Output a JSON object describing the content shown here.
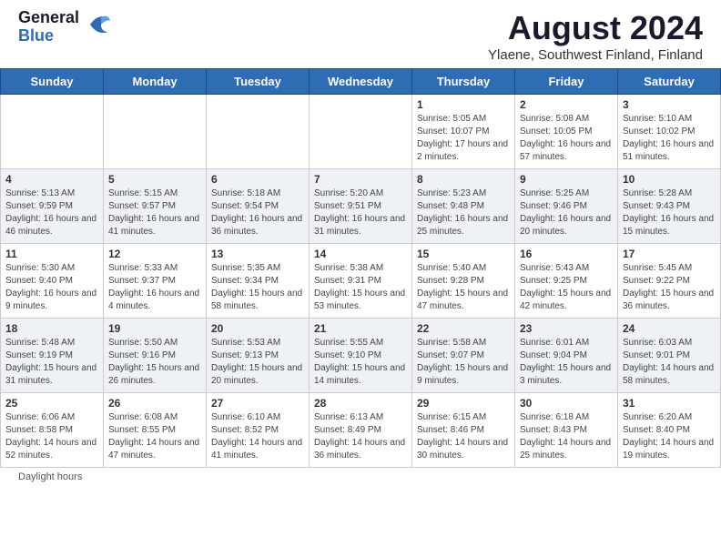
{
  "header": {
    "logo_general": "General",
    "logo_blue": "Blue",
    "main_title": "August 2024",
    "subtitle": "Ylaene, Southwest Finland, Finland"
  },
  "days": [
    "Sunday",
    "Monday",
    "Tuesday",
    "Wednesday",
    "Thursday",
    "Friday",
    "Saturday"
  ],
  "weeks": [
    [
      {
        "date": "",
        "info": ""
      },
      {
        "date": "",
        "info": ""
      },
      {
        "date": "",
        "info": ""
      },
      {
        "date": "",
        "info": ""
      },
      {
        "date": "1",
        "info": "Sunrise: 5:05 AM\nSunset: 10:07 PM\nDaylight: 17 hours\nand 2 minutes."
      },
      {
        "date": "2",
        "info": "Sunrise: 5:08 AM\nSunset: 10:05 PM\nDaylight: 16 hours\nand 57 minutes."
      },
      {
        "date": "3",
        "info": "Sunrise: 5:10 AM\nSunset: 10:02 PM\nDaylight: 16 hours\nand 51 minutes."
      }
    ],
    [
      {
        "date": "4",
        "info": "Sunrise: 5:13 AM\nSunset: 9:59 PM\nDaylight: 16 hours\nand 46 minutes."
      },
      {
        "date": "5",
        "info": "Sunrise: 5:15 AM\nSunset: 9:57 PM\nDaylight: 16 hours\nand 41 minutes."
      },
      {
        "date": "6",
        "info": "Sunrise: 5:18 AM\nSunset: 9:54 PM\nDaylight: 16 hours\nand 36 minutes."
      },
      {
        "date": "7",
        "info": "Sunrise: 5:20 AM\nSunset: 9:51 PM\nDaylight: 16 hours\nand 31 minutes."
      },
      {
        "date": "8",
        "info": "Sunrise: 5:23 AM\nSunset: 9:48 PM\nDaylight: 16 hours\nand 25 minutes."
      },
      {
        "date": "9",
        "info": "Sunrise: 5:25 AM\nSunset: 9:46 PM\nDaylight: 16 hours\nand 20 minutes."
      },
      {
        "date": "10",
        "info": "Sunrise: 5:28 AM\nSunset: 9:43 PM\nDaylight: 16 hours\nand 15 minutes."
      }
    ],
    [
      {
        "date": "11",
        "info": "Sunrise: 5:30 AM\nSunset: 9:40 PM\nDaylight: 16 hours\nand 9 minutes."
      },
      {
        "date": "12",
        "info": "Sunrise: 5:33 AM\nSunset: 9:37 PM\nDaylight: 16 hours\nand 4 minutes."
      },
      {
        "date": "13",
        "info": "Sunrise: 5:35 AM\nSunset: 9:34 PM\nDaylight: 15 hours\nand 58 minutes."
      },
      {
        "date": "14",
        "info": "Sunrise: 5:38 AM\nSunset: 9:31 PM\nDaylight: 15 hours\nand 53 minutes."
      },
      {
        "date": "15",
        "info": "Sunrise: 5:40 AM\nSunset: 9:28 PM\nDaylight: 15 hours\nand 47 minutes."
      },
      {
        "date": "16",
        "info": "Sunrise: 5:43 AM\nSunset: 9:25 PM\nDaylight: 15 hours\nand 42 minutes."
      },
      {
        "date": "17",
        "info": "Sunrise: 5:45 AM\nSunset: 9:22 PM\nDaylight: 15 hours\nand 36 minutes."
      }
    ],
    [
      {
        "date": "18",
        "info": "Sunrise: 5:48 AM\nSunset: 9:19 PM\nDaylight: 15 hours\nand 31 minutes."
      },
      {
        "date": "19",
        "info": "Sunrise: 5:50 AM\nSunset: 9:16 PM\nDaylight: 15 hours\nand 26 minutes."
      },
      {
        "date": "20",
        "info": "Sunrise: 5:53 AM\nSunset: 9:13 PM\nDaylight: 15 hours\nand 20 minutes."
      },
      {
        "date": "21",
        "info": "Sunrise: 5:55 AM\nSunset: 9:10 PM\nDaylight: 15 hours\nand 14 minutes."
      },
      {
        "date": "22",
        "info": "Sunrise: 5:58 AM\nSunset: 9:07 PM\nDaylight: 15 hours\nand 9 minutes."
      },
      {
        "date": "23",
        "info": "Sunrise: 6:01 AM\nSunset: 9:04 PM\nDaylight: 15 hours\nand 3 minutes."
      },
      {
        "date": "24",
        "info": "Sunrise: 6:03 AM\nSunset: 9:01 PM\nDaylight: 14 hours\nand 58 minutes."
      }
    ],
    [
      {
        "date": "25",
        "info": "Sunrise: 6:06 AM\nSunset: 8:58 PM\nDaylight: 14 hours\nand 52 minutes."
      },
      {
        "date": "26",
        "info": "Sunrise: 6:08 AM\nSunset: 8:55 PM\nDaylight: 14 hours\nand 47 minutes."
      },
      {
        "date": "27",
        "info": "Sunrise: 6:10 AM\nSunset: 8:52 PM\nDaylight: 14 hours\nand 41 minutes."
      },
      {
        "date": "28",
        "info": "Sunrise: 6:13 AM\nSunset: 8:49 PM\nDaylight: 14 hours\nand 36 minutes."
      },
      {
        "date": "29",
        "info": "Sunrise: 6:15 AM\nSunset: 8:46 PM\nDaylight: 14 hours\nand 30 minutes."
      },
      {
        "date": "30",
        "info": "Sunrise: 6:18 AM\nSunset: 8:43 PM\nDaylight: 14 hours\nand 25 minutes."
      },
      {
        "date": "31",
        "info": "Sunrise: 6:20 AM\nSunset: 8:40 PM\nDaylight: 14 hours\nand 19 minutes."
      }
    ]
  ],
  "footer": {
    "daylight_label": "Daylight hours"
  }
}
